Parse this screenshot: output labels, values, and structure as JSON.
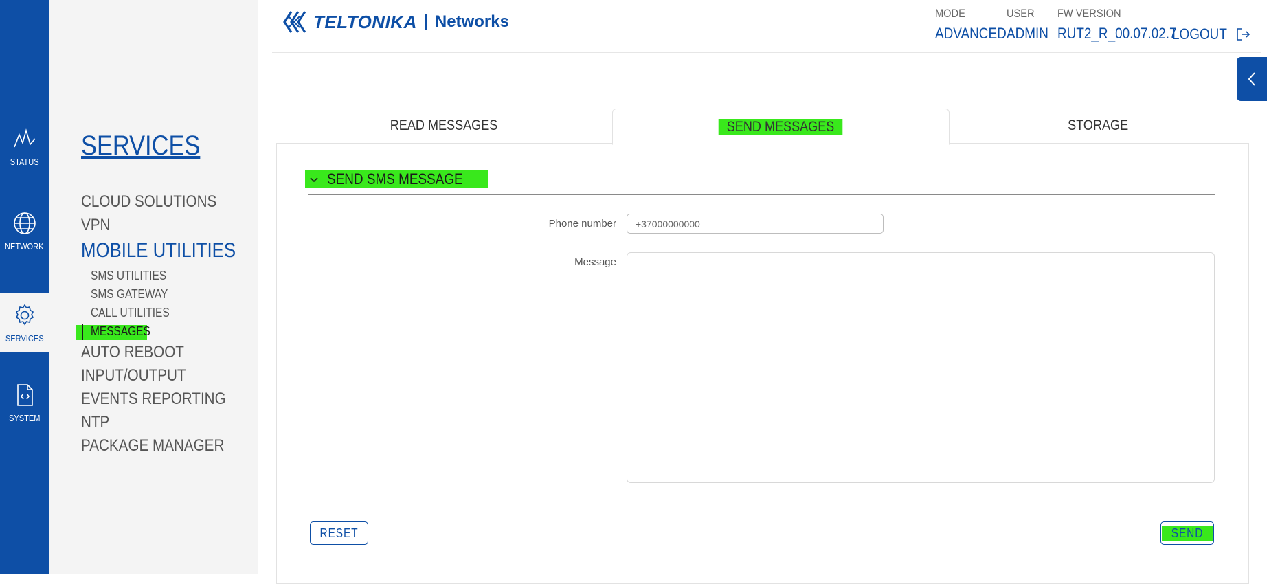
{
  "rail": {
    "items": [
      {
        "label": "STATUS",
        "icon": "chart-line-icon"
      },
      {
        "label": "NETWORK",
        "icon": "globe-icon"
      },
      {
        "label": "SERVICES",
        "icon": "gear-icon"
      },
      {
        "label": "SYSTEM",
        "icon": "code-file-icon"
      }
    ]
  },
  "submenu": {
    "title": "SERVICES",
    "items": [
      {
        "label": "CLOUD SOLUTIONS"
      },
      {
        "label": "VPN"
      },
      {
        "label": "MOBILE UTILITIES"
      },
      {
        "label": "AUTO REBOOT"
      },
      {
        "label": "INPUT/OUTPUT"
      },
      {
        "label": "EVENTS REPORTING"
      },
      {
        "label": "NTP"
      },
      {
        "label": "PACKAGE MANAGER"
      }
    ],
    "mobile_children": [
      {
        "label": "SMS UTILITIES"
      },
      {
        "label": "SMS GATEWAY"
      },
      {
        "label": "CALL UTILITIES"
      },
      {
        "label": "MESSAGES"
      }
    ]
  },
  "header": {
    "brand": "TELTONIKA",
    "brand_sub": "Networks",
    "mode_key": "MODE",
    "mode_value": "ADVANCED",
    "user_key": "USER",
    "user_value": "ADMIN",
    "fw_key": "FW VERSION",
    "fw_value": "RUT2_R_00.07.02.7",
    "logout": "LOGOUT"
  },
  "tabs": [
    {
      "label": "READ MESSAGES"
    },
    {
      "label": "SEND MESSAGES"
    },
    {
      "label": "STORAGE"
    }
  ],
  "form": {
    "section_title": "SEND SMS MESSAGE",
    "phone_label": "Phone number",
    "phone_placeholder": "+37000000000",
    "message_label": "Message",
    "reset_label": "RESET",
    "send_label": "SEND"
  },
  "colors": {
    "brand_blue": "#0e4fa6",
    "highlight": "#39e81c",
    "sidebar_bg": "#f4f4f4"
  }
}
